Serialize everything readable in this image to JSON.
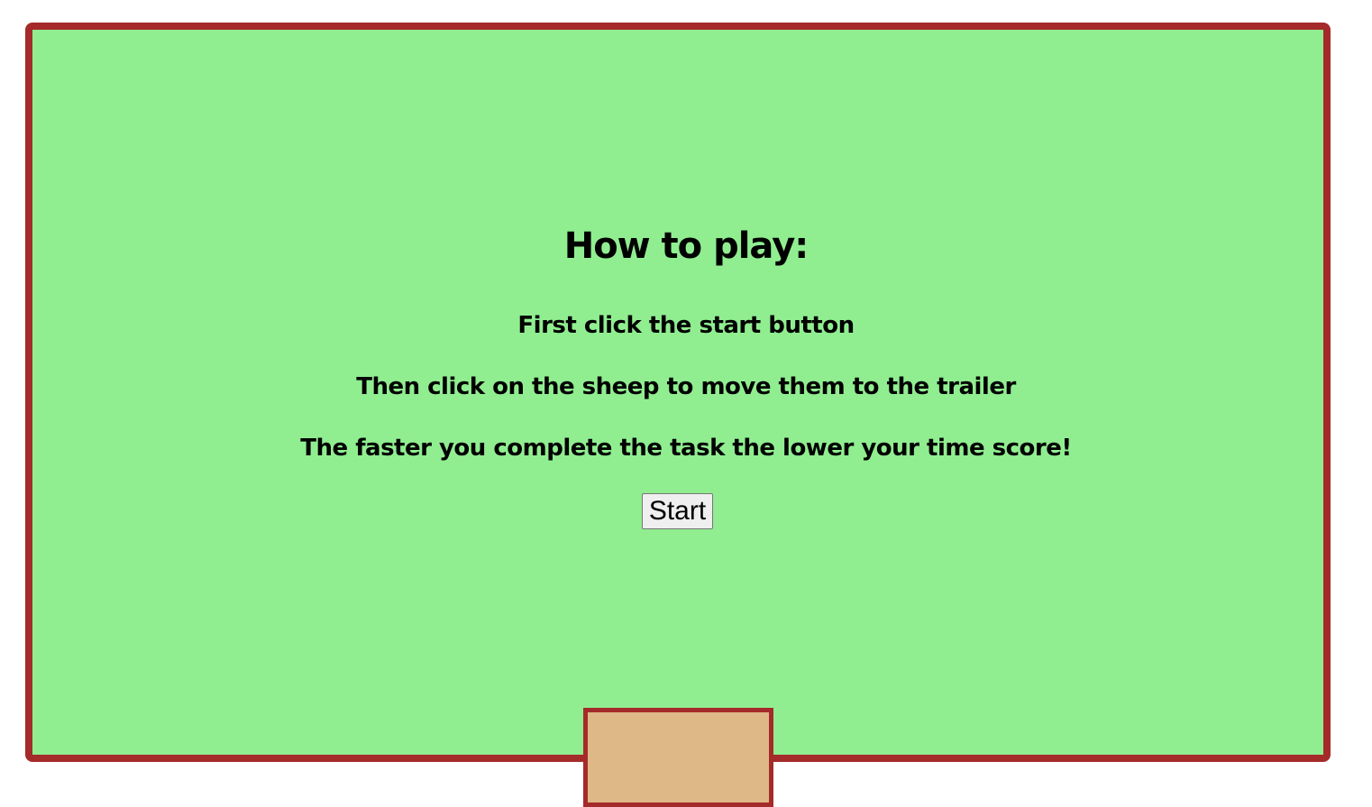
{
  "game": {
    "field_color": "#90ee90",
    "border_color": "#a52a2a",
    "trailer_color": "#deb887"
  },
  "instructions": {
    "title": "How to play:",
    "steps": [
      "First click the start button",
      "Then click on the sheep to move them to the trailer",
      "The faster you complete the task the lower your time score!"
    ]
  },
  "controls": {
    "start_label": "Start"
  }
}
